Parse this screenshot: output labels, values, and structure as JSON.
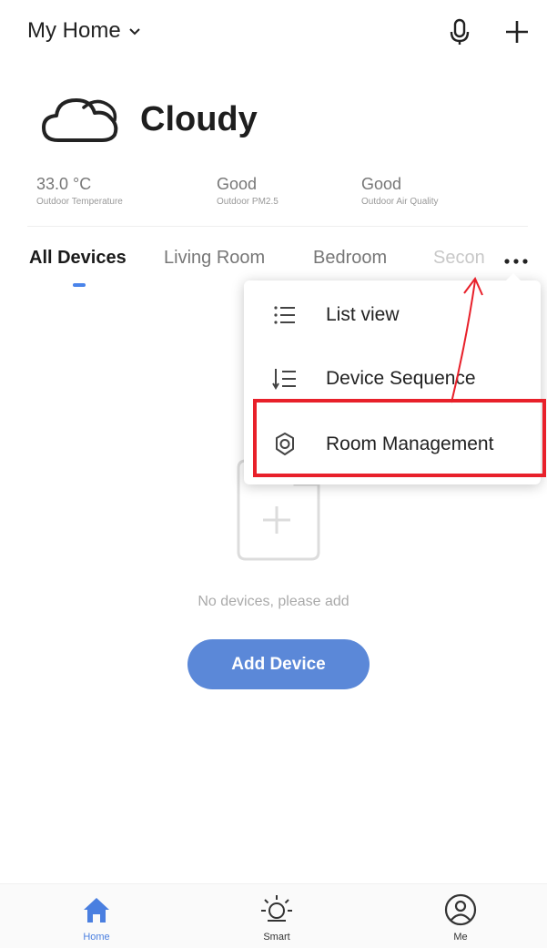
{
  "header": {
    "home_name": "My Home",
    "icons": [
      "chevron-down-icon",
      "microphone-icon",
      "plus-icon"
    ]
  },
  "weather": {
    "condition": "Cloudy",
    "icon": "cloud-icon",
    "stats": [
      {
        "value": "33.0 °C",
        "label": "Outdoor Temperature"
      },
      {
        "value": "Good",
        "label": "Outdoor PM2.5"
      },
      {
        "value": "Good",
        "label": "Outdoor Air Quality"
      }
    ]
  },
  "tabs": {
    "items": [
      "All Devices",
      "Living Room",
      "Bedroom",
      "Secon"
    ],
    "active_index": 0,
    "more_icon": "more-dots-icon"
  },
  "menu": {
    "items": [
      {
        "label": "List view",
        "icon": "list-icon"
      },
      {
        "label": "Device Sequence",
        "icon": "sort-list-icon"
      },
      {
        "label": "Room Management",
        "icon": "gear-icon"
      }
    ],
    "highlighted_index": 2
  },
  "empty_state": {
    "message": "No devices, please add",
    "button_label": "Add Device",
    "icon": "add-document-icon"
  },
  "bottom_nav": {
    "items": [
      {
        "label": "Home",
        "icon": "home-icon",
        "active": true
      },
      {
        "label": "Smart",
        "icon": "sun-icon",
        "active": false
      },
      {
        "label": "Me",
        "icon": "user-circle-icon",
        "active": false
      }
    ]
  },
  "colors": {
    "accent": "#5b88d8",
    "active_tab_indicator": "#4a84ea",
    "annotation_red": "#e8202a"
  }
}
